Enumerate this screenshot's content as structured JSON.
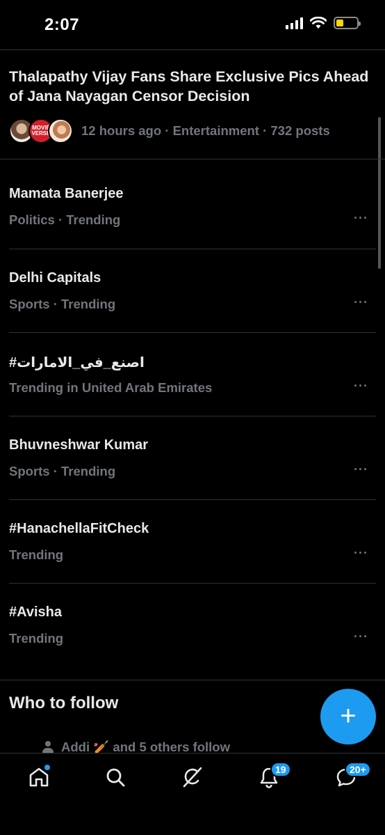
{
  "status_bar": {
    "time": "2:07"
  },
  "featured": {
    "title": "Thalapathy Vijay Fans Share Exclusive Pics Ahead of Jana Nayagan Censor Decision",
    "meta": "12 hours ago · Entertainment · 732 posts",
    "avatar2_text": "MOVIE VERSE"
  },
  "trends": [
    {
      "title": "Mamata Banerjee",
      "subtitle": "Politics · Trending",
      "more": "···"
    },
    {
      "title": "Delhi Capitals",
      "subtitle": "Sports · Trending",
      "more": "···"
    },
    {
      "title": "#اصنع_في_الامارات",
      "subtitle": "Trending in United Arab Emirates",
      "more": "···"
    },
    {
      "title": "Bhuvneshwar Kumar",
      "subtitle": "Sports · Trending",
      "more": "···"
    },
    {
      "title": "#HanachellaFitCheck",
      "subtitle": "Trending",
      "more": "···"
    },
    {
      "title": "#Avisha",
      "subtitle": "Trending",
      "more": "···"
    }
  ],
  "who_to_follow": {
    "title": "Who to follow",
    "context": "Addi 🏏 and 5 others follow"
  },
  "fab": {
    "label": "+"
  },
  "nav": {
    "items": [
      {
        "icon": "home-icon"
      },
      {
        "icon": "search-icon"
      },
      {
        "icon": "grok-icon"
      },
      {
        "icon": "notifications-icon",
        "badge": "19"
      },
      {
        "icon": "messages-icon",
        "badge": "20+"
      }
    ]
  },
  "colors": {
    "accent": "#1d9bf0",
    "text": "#e7e9ea",
    "muted": "#71767b",
    "divider": "#2f3336",
    "background": "#000000"
  }
}
